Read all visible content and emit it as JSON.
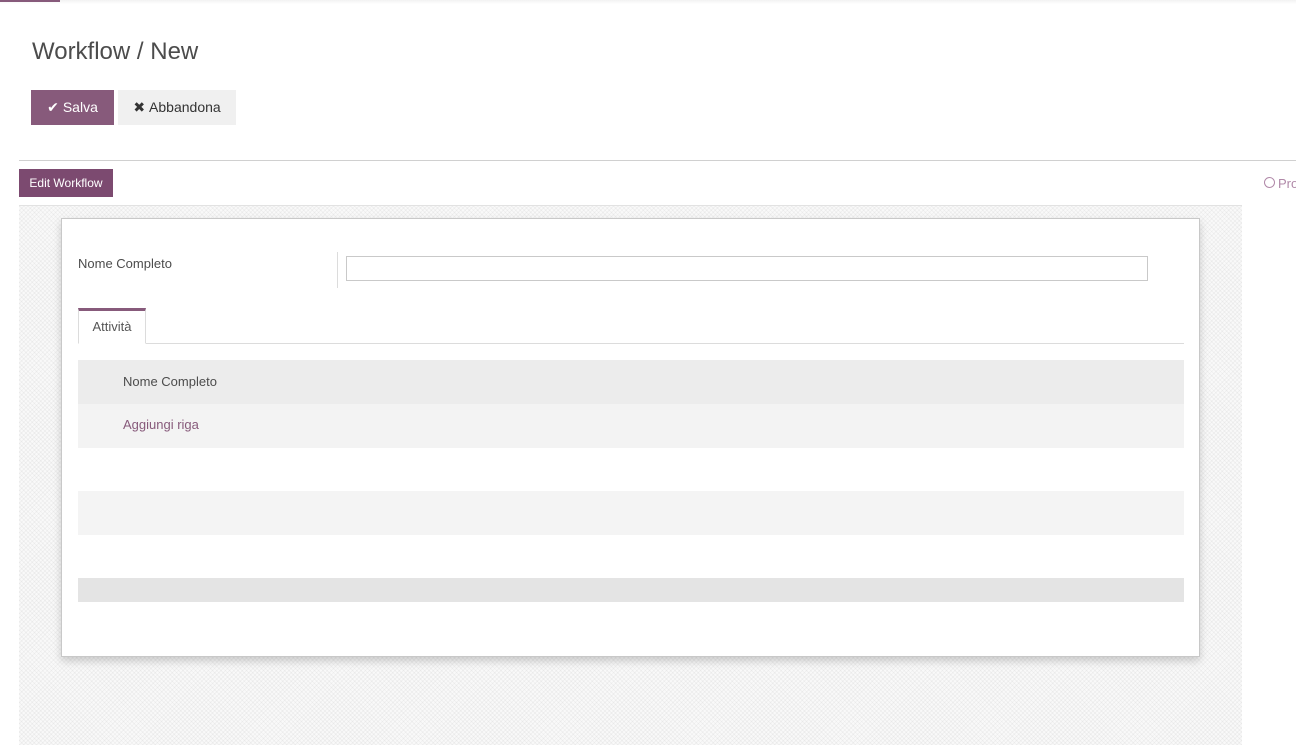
{
  "breadcrumb": "Workflow / New",
  "buttons": {
    "save_label": "Salva",
    "save_icon": "check-icon",
    "discard_label": "Abbandona",
    "discard_icon": "close-icon"
  },
  "edit_workflow_label": "Edit Workflow",
  "chatter_link_label": "Pro",
  "form": {
    "name_label": "Nome Completo",
    "name_value": ""
  },
  "tabs": [
    {
      "label": "Attività",
      "active": true
    }
  ],
  "table": {
    "columns": [
      "Nome Completo"
    ],
    "add_line_label": "Aggiungi riga"
  },
  "colors": {
    "accent": "#875a7b"
  }
}
